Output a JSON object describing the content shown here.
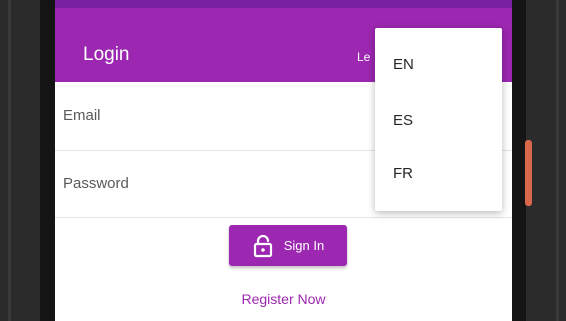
{
  "app_bar": {
    "title": "Login",
    "language_button_label": "Le",
    "color": "#9c27b0",
    "status_bar_color": "#7b1fa2"
  },
  "form": {
    "email_placeholder": "Email",
    "password_placeholder": "Password",
    "sign_in_label": "Sign In",
    "sign_in_icon": "lock-open-icon",
    "register_label": "Register Now"
  },
  "language_menu": {
    "items": [
      {
        "label": "EN"
      },
      {
        "label": "ES"
      },
      {
        "label": "FR"
      }
    ]
  },
  "colors": {
    "accent": "#9c27b0",
    "device_frame": "#2b2b2b",
    "side_button": "#d9684a"
  }
}
